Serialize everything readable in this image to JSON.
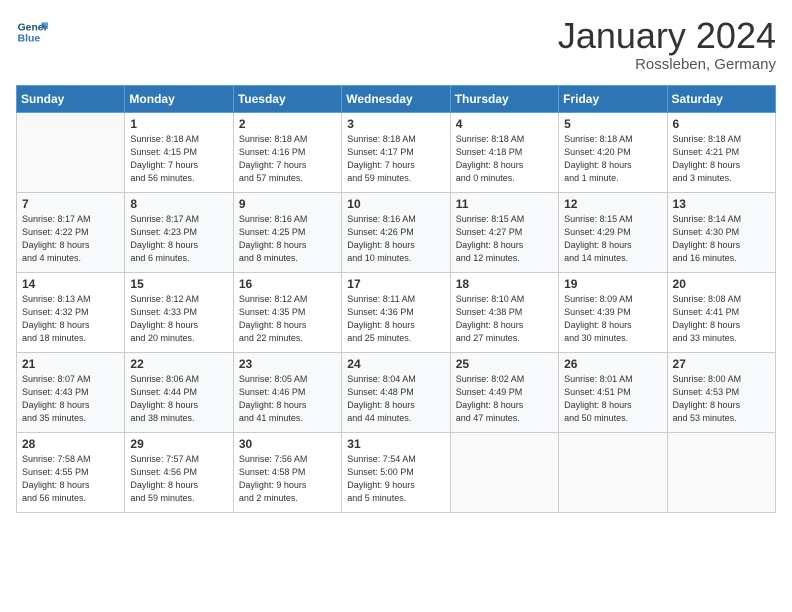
{
  "header": {
    "logo_line1": "General",
    "logo_line2": "Blue",
    "month_title": "January 2024",
    "location": "Rossleben, Germany"
  },
  "days_of_week": [
    "Sunday",
    "Monday",
    "Tuesday",
    "Wednesday",
    "Thursday",
    "Friday",
    "Saturday"
  ],
  "weeks": [
    [
      {
        "day": "",
        "info": ""
      },
      {
        "day": "1",
        "info": "Sunrise: 8:18 AM\nSunset: 4:15 PM\nDaylight: 7 hours\nand 56 minutes."
      },
      {
        "day": "2",
        "info": "Sunrise: 8:18 AM\nSunset: 4:16 PM\nDaylight: 7 hours\nand 57 minutes."
      },
      {
        "day": "3",
        "info": "Sunrise: 8:18 AM\nSunset: 4:17 PM\nDaylight: 7 hours\nand 59 minutes."
      },
      {
        "day": "4",
        "info": "Sunrise: 8:18 AM\nSunset: 4:18 PM\nDaylight: 8 hours\nand 0 minutes."
      },
      {
        "day": "5",
        "info": "Sunrise: 8:18 AM\nSunset: 4:20 PM\nDaylight: 8 hours\nand 1 minute."
      },
      {
        "day": "6",
        "info": "Sunrise: 8:18 AM\nSunset: 4:21 PM\nDaylight: 8 hours\nand 3 minutes."
      }
    ],
    [
      {
        "day": "7",
        "info": "Sunrise: 8:17 AM\nSunset: 4:22 PM\nDaylight: 8 hours\nand 4 minutes."
      },
      {
        "day": "8",
        "info": "Sunrise: 8:17 AM\nSunset: 4:23 PM\nDaylight: 8 hours\nand 6 minutes."
      },
      {
        "day": "9",
        "info": "Sunrise: 8:16 AM\nSunset: 4:25 PM\nDaylight: 8 hours\nand 8 minutes."
      },
      {
        "day": "10",
        "info": "Sunrise: 8:16 AM\nSunset: 4:26 PM\nDaylight: 8 hours\nand 10 minutes."
      },
      {
        "day": "11",
        "info": "Sunrise: 8:15 AM\nSunset: 4:27 PM\nDaylight: 8 hours\nand 12 minutes."
      },
      {
        "day": "12",
        "info": "Sunrise: 8:15 AM\nSunset: 4:29 PM\nDaylight: 8 hours\nand 14 minutes."
      },
      {
        "day": "13",
        "info": "Sunrise: 8:14 AM\nSunset: 4:30 PM\nDaylight: 8 hours\nand 16 minutes."
      }
    ],
    [
      {
        "day": "14",
        "info": "Sunrise: 8:13 AM\nSunset: 4:32 PM\nDaylight: 8 hours\nand 18 minutes."
      },
      {
        "day": "15",
        "info": "Sunrise: 8:12 AM\nSunset: 4:33 PM\nDaylight: 8 hours\nand 20 minutes."
      },
      {
        "day": "16",
        "info": "Sunrise: 8:12 AM\nSunset: 4:35 PM\nDaylight: 8 hours\nand 22 minutes."
      },
      {
        "day": "17",
        "info": "Sunrise: 8:11 AM\nSunset: 4:36 PM\nDaylight: 8 hours\nand 25 minutes."
      },
      {
        "day": "18",
        "info": "Sunrise: 8:10 AM\nSunset: 4:38 PM\nDaylight: 8 hours\nand 27 minutes."
      },
      {
        "day": "19",
        "info": "Sunrise: 8:09 AM\nSunset: 4:39 PM\nDaylight: 8 hours\nand 30 minutes."
      },
      {
        "day": "20",
        "info": "Sunrise: 8:08 AM\nSunset: 4:41 PM\nDaylight: 8 hours\nand 33 minutes."
      }
    ],
    [
      {
        "day": "21",
        "info": "Sunrise: 8:07 AM\nSunset: 4:43 PM\nDaylight: 8 hours\nand 35 minutes."
      },
      {
        "day": "22",
        "info": "Sunrise: 8:06 AM\nSunset: 4:44 PM\nDaylight: 8 hours\nand 38 minutes."
      },
      {
        "day": "23",
        "info": "Sunrise: 8:05 AM\nSunset: 4:46 PM\nDaylight: 8 hours\nand 41 minutes."
      },
      {
        "day": "24",
        "info": "Sunrise: 8:04 AM\nSunset: 4:48 PM\nDaylight: 8 hours\nand 44 minutes."
      },
      {
        "day": "25",
        "info": "Sunrise: 8:02 AM\nSunset: 4:49 PM\nDaylight: 8 hours\nand 47 minutes."
      },
      {
        "day": "26",
        "info": "Sunrise: 8:01 AM\nSunset: 4:51 PM\nDaylight: 8 hours\nand 50 minutes."
      },
      {
        "day": "27",
        "info": "Sunrise: 8:00 AM\nSunset: 4:53 PM\nDaylight: 8 hours\nand 53 minutes."
      }
    ],
    [
      {
        "day": "28",
        "info": "Sunrise: 7:58 AM\nSunset: 4:55 PM\nDaylight: 8 hours\nand 56 minutes."
      },
      {
        "day": "29",
        "info": "Sunrise: 7:57 AM\nSunset: 4:56 PM\nDaylight: 8 hours\nand 59 minutes."
      },
      {
        "day": "30",
        "info": "Sunrise: 7:56 AM\nSunset: 4:58 PM\nDaylight: 9 hours\nand 2 minutes."
      },
      {
        "day": "31",
        "info": "Sunrise: 7:54 AM\nSunset: 5:00 PM\nDaylight: 9 hours\nand 5 minutes."
      },
      {
        "day": "",
        "info": ""
      },
      {
        "day": "",
        "info": ""
      },
      {
        "day": "",
        "info": ""
      }
    ]
  ]
}
